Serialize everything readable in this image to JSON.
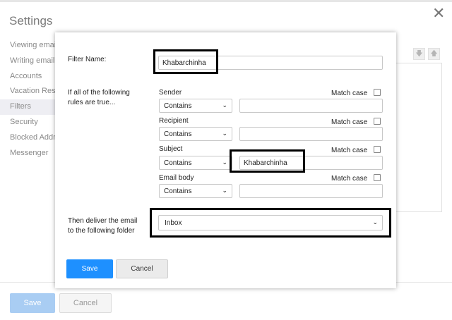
{
  "background": {
    "title": "Settings",
    "close_glyph": "✕",
    "sidebar": [
      {
        "label": "Viewing email"
      },
      {
        "label": "Writing email"
      },
      {
        "label": "Accounts"
      },
      {
        "label": "Vacation Resp"
      },
      {
        "label": "Filters"
      },
      {
        "label": "Security"
      },
      {
        "label": "Blocked Addre"
      },
      {
        "label": "Messenger"
      }
    ],
    "move_down_glyph": "🡇",
    "move_up_glyph": "🡅",
    "save_label": "Save",
    "cancel_label": "Cancel"
  },
  "dialog": {
    "filter_name_label": "Filter Name:",
    "filter_name_value": "Khabarchinha",
    "rules_label_line1": "If all of the following",
    "rules_label_line2": "rules are true...",
    "rules": [
      {
        "field": "Sender",
        "operator": "Contains",
        "value": "",
        "match_case": "Match case"
      },
      {
        "field": "Recipient",
        "operator": "Contains",
        "value": "",
        "match_case": "Match case"
      },
      {
        "field": "Subject",
        "operator": "Contains",
        "value": "Khabarchinha",
        "match_case": "Match case"
      },
      {
        "field": "Email body",
        "operator": "Contains",
        "value": "",
        "match_case": "Match case"
      }
    ],
    "deliver_label_line1": "Then deliver the email",
    "deliver_label_line2": "to the following folder",
    "folder_value": "Inbox",
    "save_label": "Save",
    "cancel_label": "Cancel"
  },
  "colors": {
    "primary_button": "#1e90ff",
    "highlight_box": "#000000"
  }
}
